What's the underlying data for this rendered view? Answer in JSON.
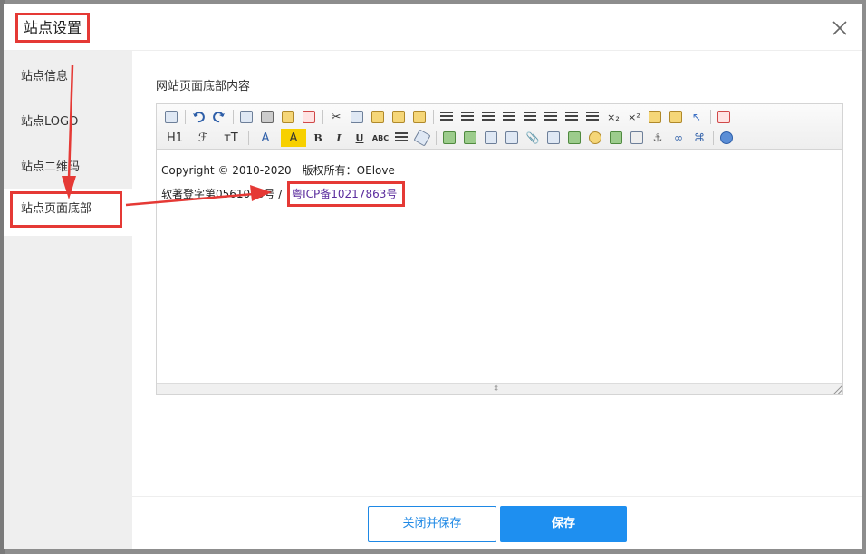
{
  "dialog": {
    "title": "站点设置",
    "close_icon": "close-icon"
  },
  "sidebar": {
    "items": [
      {
        "label": "站点信息"
      },
      {
        "label": "站点LOGO"
      },
      {
        "label": "站点二维码"
      },
      {
        "label": "站点页面底部"
      }
    ]
  },
  "form": {
    "field_label": "网站页面底部内容"
  },
  "editor": {
    "line1": "Copyright © 2010-2020　版权所有：OElove",
    "line2_prefix": "软著登字第0561018号 / ",
    "line2_link": "粤ICP备10217863号",
    "toolbar_row1": [
      "source-icon",
      "undo-icon",
      "redo-icon",
      "preview-icon",
      "print-icon",
      "template-icon",
      "code-icon",
      "cut-icon",
      "copy-icon",
      "paste-icon",
      "paste-plain-icon",
      "paste-word-icon",
      "align-left-icon",
      "align-center-icon",
      "align-right-icon",
      "justify-icon",
      "ordered-list-icon",
      "unordered-list-icon",
      "indent-icon",
      "outdent-icon",
      "subscript-icon",
      "superscript-icon",
      "clear-format-icon",
      "select-all-icon",
      "pointer-icon",
      "fullscreen-icon"
    ],
    "toolbar_row2": [
      "heading-icon",
      "font-family-icon",
      "font-size-icon",
      "font-color-icon",
      "highlight-icon",
      "bold-icon",
      "italic-icon",
      "underline-icon",
      "strikethrough-icon",
      "line-height-icon",
      "eraser-icon",
      "image-icon",
      "multi-image-icon",
      "flash-icon",
      "media-icon",
      "attachment-icon",
      "table-icon",
      "insert-row-icon",
      "emoticon-icon",
      "map-icon",
      "page-break-icon",
      "anchor-icon",
      "link-icon",
      "unlink-icon",
      "help-icon"
    ],
    "tb_h1": "H1",
    "tb_font": "ℱ",
    "tb_size": "тT",
    "tb_color": "A",
    "tb_bold": "B",
    "tb_italic": "I",
    "tb_underline": "U",
    "tb_abc": "ABC",
    "tb_sub": "×₂",
    "tb_sup": "×²"
  },
  "footer": {
    "close_save_label": "关闭并保存",
    "save_label": "保存"
  },
  "colors": {
    "accent": "#1e8ff0",
    "annotation": "#e53935",
    "sidebar_bg": "#efefef"
  }
}
